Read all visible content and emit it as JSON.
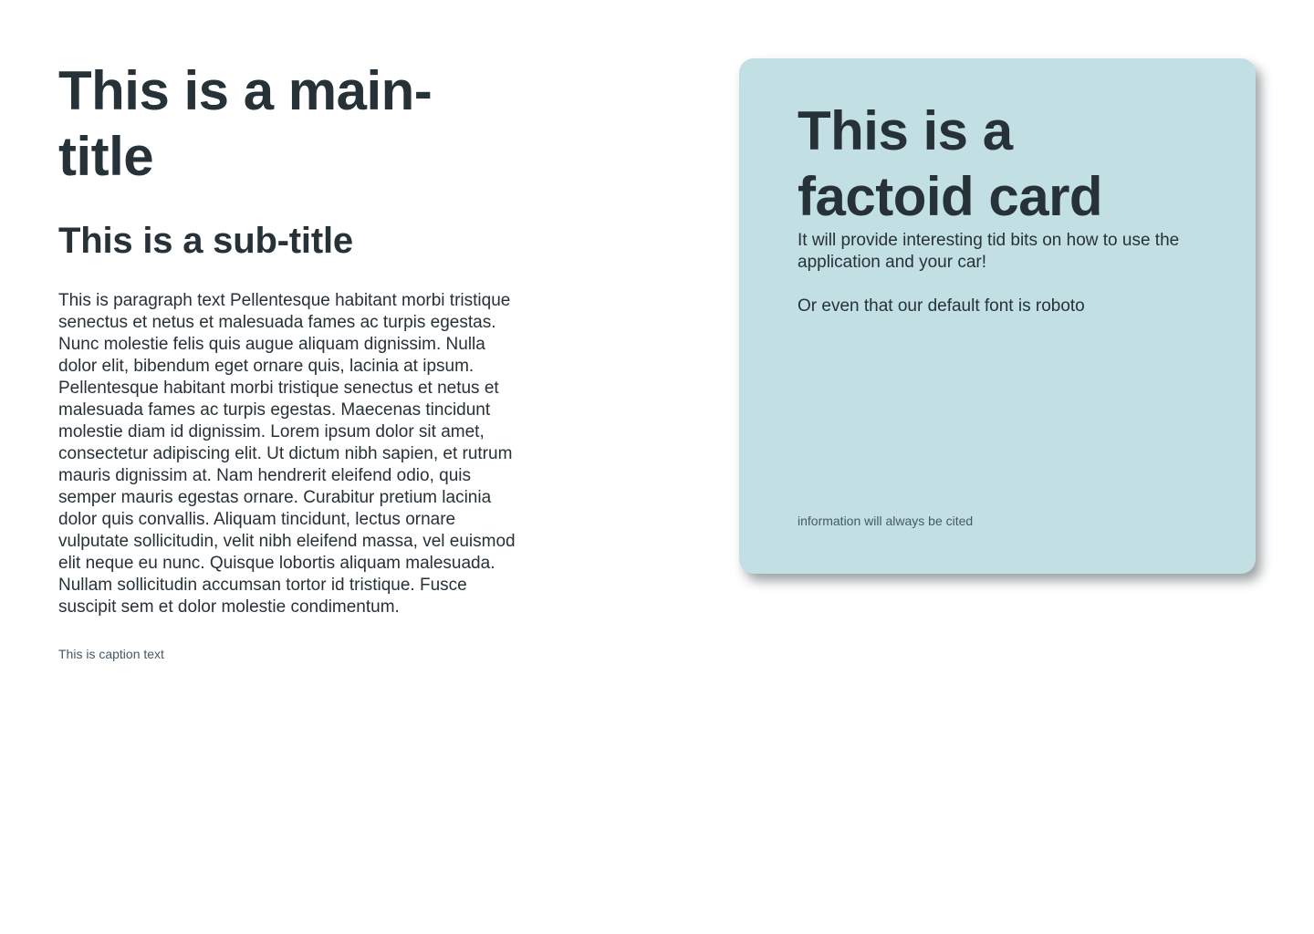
{
  "content": {
    "main_title": "This is a main-title",
    "sub_title": "This is a sub-title",
    "paragraph": "This is paragraph text Pellentesque habitant morbi tristique senectus et netus et malesuada fames ac turpis egestas. Nunc molestie felis quis augue aliquam dignissim. Nulla dolor elit, bibendum eget ornare quis, lacinia at ipsum. Pellentesque habitant morbi tristique senectus et netus et malesuada fames ac turpis egestas. Maecenas tincidunt molestie diam id dignissim. Lorem ipsum dolor sit amet, consectetur adipiscing elit. Ut dictum nibh sapien, et rutrum mauris dignissim at. Nam hendrerit eleifend odio, quis semper mauris egestas ornare. Curabitur pretium lacinia dolor quis convallis. Aliquam tincidunt, lectus ornare vulputate sollicitudin, velit nibh eleifend massa, vel euismod elit neque eu nunc. Quisque lobortis aliquam malesuada. Nullam sollicitudin accumsan tortor id tristique. Fusce suscipit sem et dolor molestie condimentum.",
    "caption": "This is caption text"
  },
  "factoid_card": {
    "title": "This is a factoid card",
    "text_1": "It will provide interesting tid bits on how to use the application and your car!",
    "text_2": "Or even that our default font is roboto",
    "citation": "information will always be cited"
  },
  "colors": {
    "text_primary": "#263238",
    "text_secondary": "#455a64",
    "card_background": "#c2dfe3",
    "page_background": "#ffffff"
  }
}
